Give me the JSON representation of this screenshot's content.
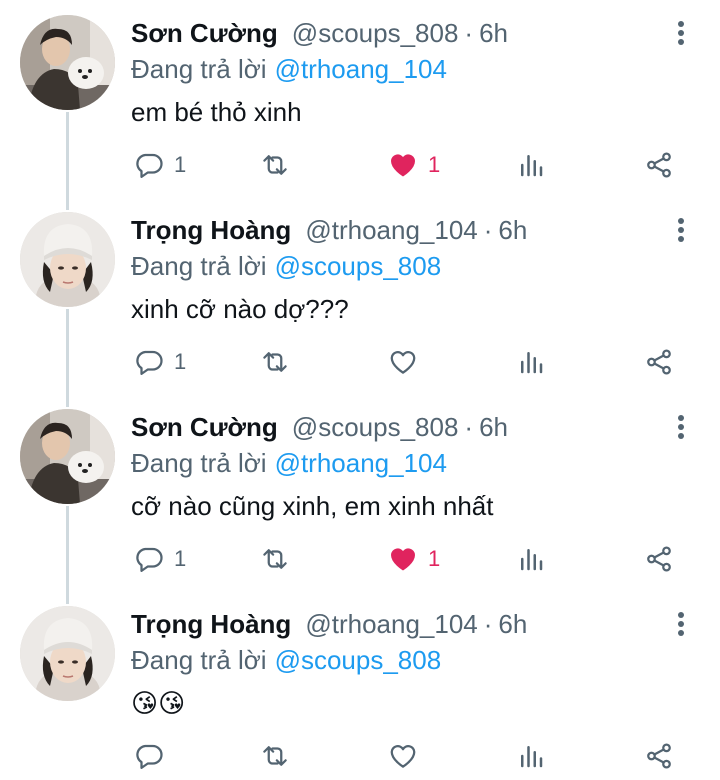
{
  "tweets": [
    {
      "author_name": "Sơn Cường",
      "handle": "@scoups_808",
      "separator": "·",
      "time": "6h",
      "reply_prefix": "Đang trả lời",
      "reply_to": "@trhoang_104",
      "text": "em bé thỏ xinh",
      "reply_count": "1",
      "like_count": "1",
      "liked": true,
      "avatar": "user-photo-man-with-dog"
    },
    {
      "author_name": "Trọng Hoàng",
      "handle": "@trhoang_104",
      "separator": "·",
      "time": "6h",
      "reply_prefix": "Đang trả lời",
      "reply_to": "@scoups_808",
      "text": "xinh cỡ nào dợ???",
      "reply_count": "1",
      "like_count": "",
      "liked": false,
      "avatar": "user-photo-man-white-beanie"
    },
    {
      "author_name": "Sơn Cường",
      "handle": "@scoups_808",
      "separator": "·",
      "time": "6h",
      "reply_prefix": "Đang trả lời",
      "reply_to": "@trhoang_104",
      "text": "cỡ nào cũng xinh, em xinh nhất",
      "reply_count": "1",
      "like_count": "1",
      "liked": true,
      "avatar": "user-photo-man-with-dog"
    },
    {
      "author_name": "Trọng Hoàng",
      "handle": "@trhoang_104",
      "separator": "·",
      "time": "6h",
      "reply_prefix": "Đang trả lời",
      "reply_to": "@scoups_808",
      "text": "😘😘",
      "reply_count": "",
      "like_count": "",
      "liked": false,
      "avatar": "user-photo-man-white-beanie"
    }
  ],
  "icons": {
    "reply": "speech-bubble-icon",
    "retweet": "retweet-arrows-icon",
    "like": "heart-icon",
    "stats": "bar-chart-icon",
    "share": "share-nodes-icon",
    "more": "vertical-ellipsis-icon"
  },
  "colors": {
    "link": "#1d9bf0",
    "muted": "#536471",
    "liked": "#e0245e",
    "text": "#0f1419",
    "thread_line": "#cfd9de"
  }
}
